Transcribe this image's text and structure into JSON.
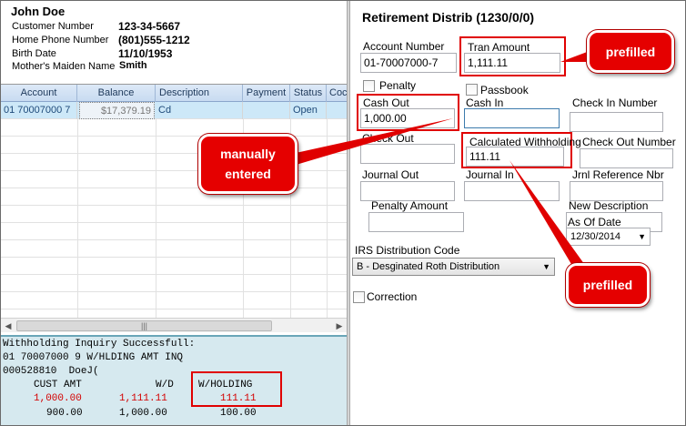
{
  "customer": {
    "name": "John Doe",
    "fields": [
      {
        "label": "Customer Number",
        "value": "123-34-5667"
      },
      {
        "label": "Home Phone Number",
        "value": "(801)555-1212"
      },
      {
        "label": "Birth Date",
        "value": "11/10/1953"
      },
      {
        "label": "Mother's Maiden Name",
        "value": "Smith"
      }
    ]
  },
  "grid": {
    "columns": [
      "Account",
      "Balance",
      "Description",
      "Payment",
      "Status",
      "Coc"
    ],
    "rows": [
      {
        "account": "01 70007000 7",
        "balance": "$17,379.19",
        "description": "Cd",
        "payment": "",
        "status": "Open"
      }
    ]
  },
  "terminal": {
    "line1": "Withholding Inquiry Successfull:",
    "line2": "01 70007000 9 W/HLDING AMT INQ",
    "line3": "000528810  DoeJ(",
    "headers": {
      "cust_amt": "CUST AMT",
      "wd": "W/D",
      "wholding": "W/HOLDING"
    },
    "row1": {
      "cust_amt": "1,000.00",
      "wd": "1,111.11",
      "wholding": "111.11"
    },
    "row2": {
      "cust_amt": "900.00",
      "wd": "1,000.00",
      "wholding": "100.00"
    }
  },
  "form": {
    "title": "Retirement Distrib (1230/0/0)",
    "account_number_label": "Account Number",
    "account_number": "01-70007000-7",
    "tran_amount_label": "Tran Amount",
    "tran_amount": "1,111.11",
    "penalty_label": "Penalty",
    "passbook_label": "Passbook",
    "cash_out_label": "Cash Out",
    "cash_out": "1,000.00",
    "cash_in_label": "Cash In",
    "check_in_number_label": "Check In Number",
    "check_out_label": "Check Out",
    "calc_withholding_label": "Calculated Withholding",
    "calc_withholding": "111.11",
    "check_out_number_label": "Check Out Number",
    "journal_out_label": "Journal Out",
    "journal_in_label": "Journal In",
    "jrnl_ref_label": "Jrnl Reference Nbr",
    "penalty_amount_label": "Penalty Amount",
    "new_description_label": "New Description",
    "as_of_date_label": "As Of Date",
    "as_of_date": "12/30/2014",
    "irs_code_label": "IRS Distribution Code",
    "irs_code": "B  - Desginated Roth Distribution",
    "correction_label": "Correction"
  },
  "annotations": {
    "prefilled_1": "prefilled",
    "prefilled_2": "prefilled",
    "manually_entered": "manually\nentered"
  },
  "colors": {
    "annotation_red": "#e50000",
    "terminal_bg": "#d6e9ef",
    "selected_row": "#cde8f8"
  }
}
